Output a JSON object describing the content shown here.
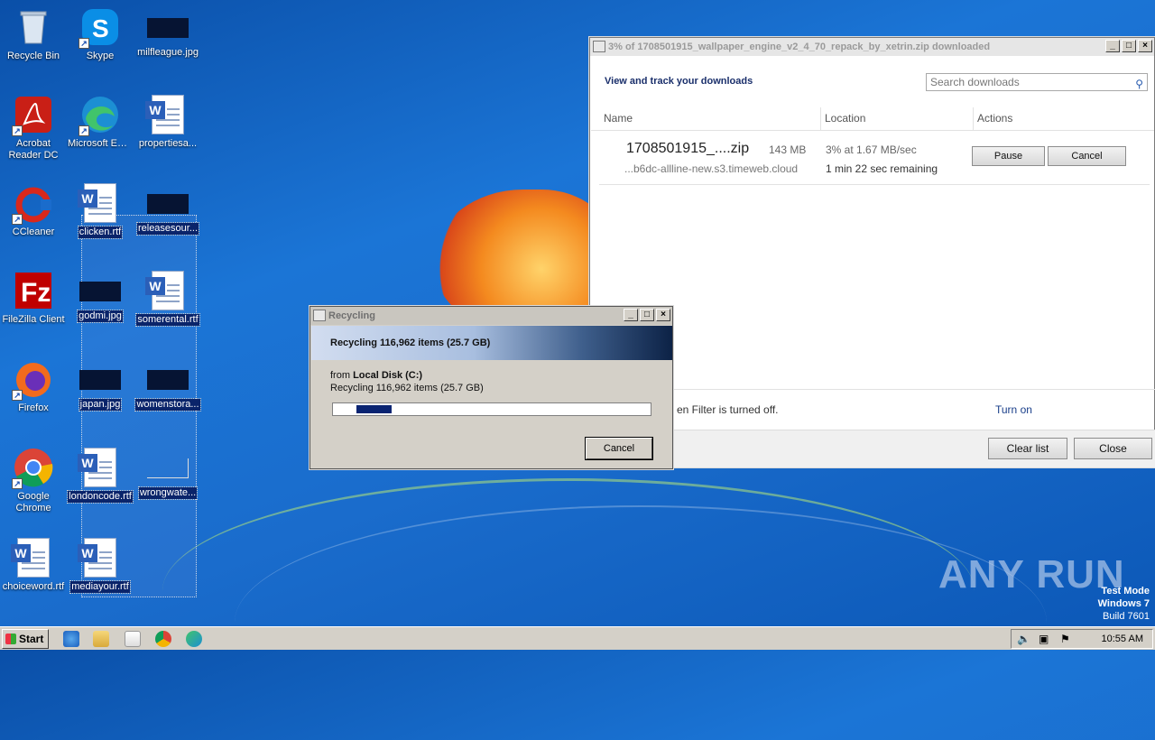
{
  "desktop_icons": [
    {
      "label": "Recycle Bin",
      "icon": "recycle-bin-icon"
    },
    {
      "label": "Skype",
      "icon": "skype-icon"
    },
    {
      "label": "milfleague.jpg",
      "icon": "image-file-icon"
    },
    {
      "label": "Acrobat Reader DC",
      "icon": "acrobat-icon"
    },
    {
      "label": "Microsoft Edge",
      "icon": "edge-icon"
    },
    {
      "label": "propertiesa...",
      "icon": "word-doc-icon"
    },
    {
      "label": "CCleaner",
      "icon": "ccleaner-icon"
    },
    {
      "label": "clicken.rtf",
      "icon": "word-doc-icon"
    },
    {
      "label": "releasesour...",
      "icon": "image-file-icon"
    },
    {
      "label": "FileZilla Client",
      "icon": "filezilla-icon"
    },
    {
      "label": "godmi.jpg",
      "icon": "image-file-icon"
    },
    {
      "label": "somerental.rtf",
      "icon": "word-doc-icon"
    },
    {
      "label": "Firefox",
      "icon": "firefox-icon"
    },
    {
      "label": "japan.jpg",
      "icon": "image-file-icon"
    },
    {
      "label": "womenstora...",
      "icon": "image-file-icon"
    },
    {
      "label": "Google Chrome",
      "icon": "chrome-icon"
    },
    {
      "label": "londoncode.rtf",
      "icon": "word-doc-icon"
    },
    {
      "label": "wrongwate...",
      "icon": "image-file-icon"
    },
    {
      "label": "choiceword.rtf",
      "icon": "word-doc-icon"
    },
    {
      "label": "mediayour.rtf",
      "icon": "word-doc-icon"
    }
  ],
  "downloads": {
    "title": "3% of 1708501915_wallpaper_engine_v2_4_70_repack_by_xetrin.zip downloaded",
    "header": "View and track your downloads",
    "search_placeholder": "Search downloads",
    "columns": [
      "Name",
      "Location",
      "Actions"
    ],
    "item": {
      "name": "1708501915_....zip",
      "size": "143 MB",
      "host": "...b6dc-allline-new.s3.timeweb.cloud",
      "status": "3% at 1.67 MB/sec",
      "remaining": "1 min 22 sec remaining",
      "pause_label": "Pause",
      "cancel_label": "Cancel"
    },
    "filter_text": "en Filter is turned off.",
    "filter_action": "Turn on",
    "clear_label": "Clear list",
    "close_label": "Close"
  },
  "recycling": {
    "title": "Recycling",
    "banner": "Recycling 116,962 items (25.7 GB)",
    "from_prefix": "from",
    "from_location": "Local Disk (C:)",
    "detail": "Recycling 116,962 items (25.7 GB)",
    "progress": 0.11,
    "cancel_label": "Cancel"
  },
  "watermark": "ANY RUN",
  "test_mode": {
    "line1": "Test Mode",
    "line2": "Windows 7",
    "line3": "Build 7601"
  },
  "taskbar": {
    "start_label": "Start",
    "clock": "10:55 AM",
    "pinned": [
      "ie-icon",
      "explorer-icon",
      "media-player-icon",
      "chrome-icon",
      "edge-icon"
    ]
  }
}
